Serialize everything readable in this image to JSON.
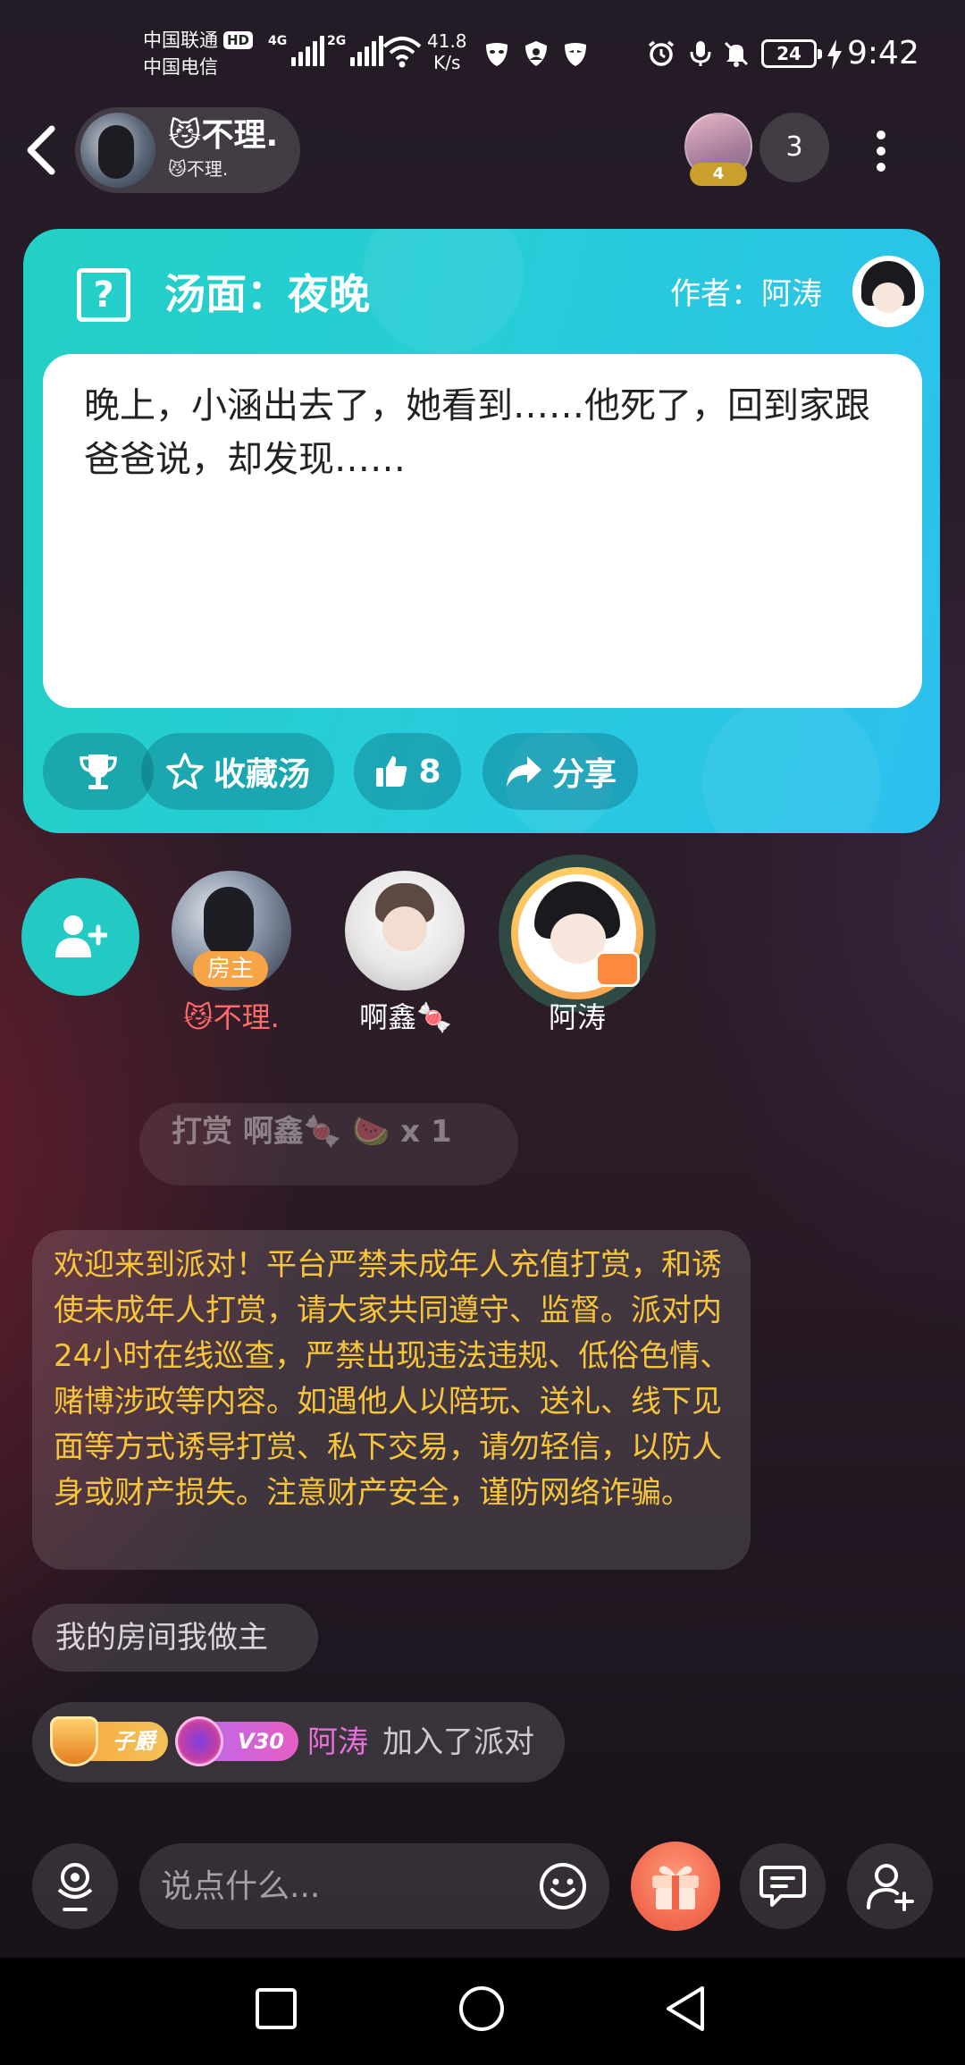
{
  "status_bar": {
    "carrier1": "中国联通",
    "hd_label": "HD",
    "carrier2": "中国电信",
    "net1": "4G",
    "net2": "2G",
    "speed_value": "41.8",
    "speed_unit": "K/s",
    "battery": "24",
    "time": "9:42"
  },
  "header": {
    "room_title": "😼不理.",
    "room_subtitle": "😼不理.",
    "viewer_badge": "4",
    "online_count": "3"
  },
  "puzzle": {
    "title": "汤面：夜晚",
    "author": "作者：阿涛",
    "story": "晚上，小涵出去了，她看到……他死了，回到家跟爸爸说，却发现……",
    "favorite_label": "收藏汤",
    "likes": "8",
    "share_label": "分享"
  },
  "seats": [
    {
      "name": "😼不理.",
      "badge": "房主",
      "name_color": "#ff6b6b"
    },
    {
      "name": "啊鑫🍬",
      "badge": "",
      "name_color": "#ffffff"
    },
    {
      "name": "阿涛",
      "badge": "",
      "name_color": "#ffffff"
    }
  ],
  "chat": {
    "gift_message": "打赏 啊鑫🍬  🍉 x 1",
    "notice": "欢迎来到派对！平台严禁未成年人充值打赏，和诱使未成年人打赏，请大家共同遵守、监督。派对内24小时在线巡查，严禁出现违法违规、低俗色情、赌博涉政等内容。如遇他人以陪玩、送礼、线下见面等方式诱导打赏、私下交易，请勿轻信，以防人身或财产损失。注意财产安全，谨防网络诈骗。",
    "room_message": "我的房间我做主",
    "join_badge1": "子爵",
    "join_badge2": "V30",
    "join_name": "阿涛",
    "join_text": "加入了派对"
  },
  "input": {
    "placeholder": "说点什么..."
  },
  "colors": {
    "accent_teal": "#23c9c3",
    "card_gradient_start": "#22d0c4",
    "card_gradient_end": "#2cc0ee",
    "notice_text": "#f7c53c",
    "join_name": "#e870d7",
    "gift_button": "#f0664d"
  }
}
